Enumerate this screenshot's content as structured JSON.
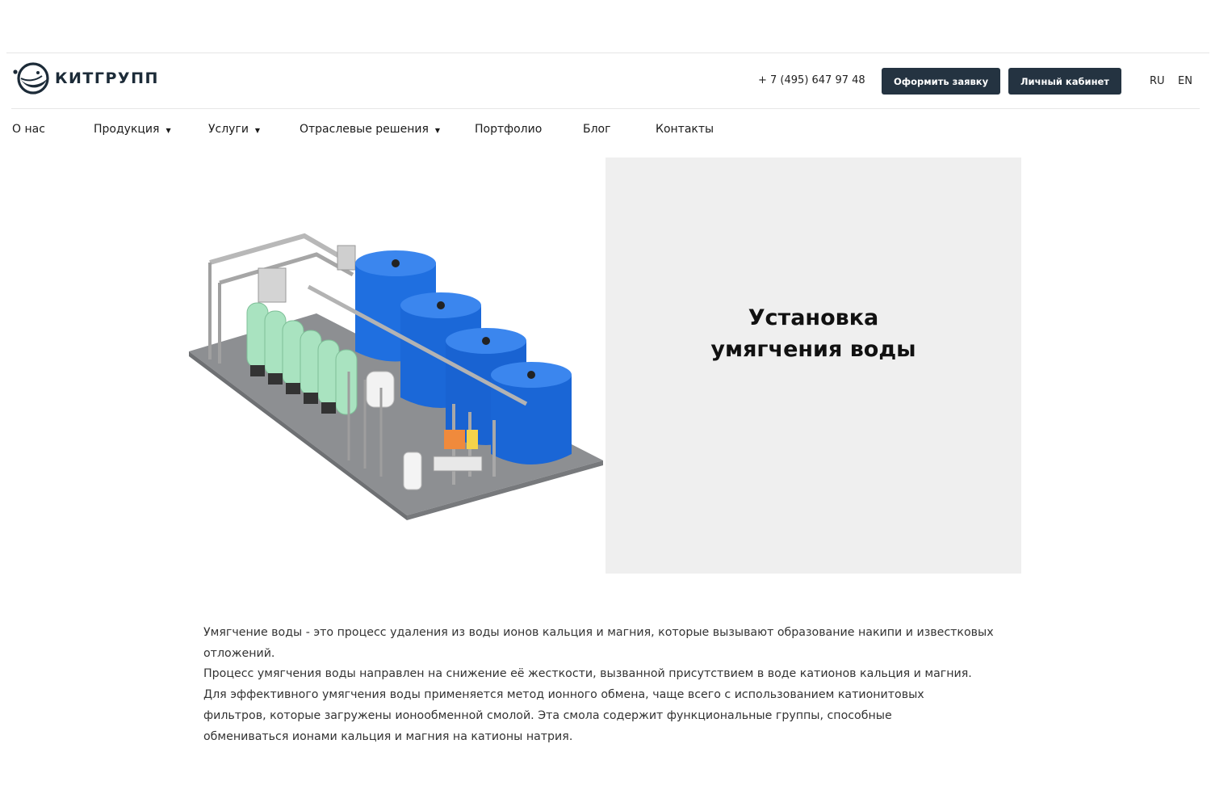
{
  "brand": {
    "name": "КИТГРУПП"
  },
  "header": {
    "phone": "+ 7 (495) 647 97 48",
    "order_button": "Оформить заявку",
    "cabinet_button": "Личный кабинет",
    "languages": [
      "RU",
      "EN"
    ]
  },
  "nav": {
    "items": [
      {
        "label": "О нас",
        "has_dropdown": false
      },
      {
        "label": "Продукция",
        "has_dropdown": true
      },
      {
        "label": "Услуги",
        "has_dropdown": true
      },
      {
        "label": "Отраслевые решения",
        "has_dropdown": true
      },
      {
        "label": "Портфолио",
        "has_dropdown": false
      },
      {
        "label": "Блог",
        "has_dropdown": false
      },
      {
        "label": "Контакты",
        "has_dropdown": false
      }
    ]
  },
  "hero": {
    "title": "Установка умягчения воды",
    "image": "water-softening-plant-illustration"
  },
  "content": {
    "paragraphs": [
      "Умягчение воды - это процесс удаления из воды ионов кальция и магния, которые вызывают образование накипи и известковых отложений.",
      "Процесс умягчения воды направлен на снижение её жесткости, вызванной присутствием в воде катионов кальция и магния. Для эффективного умягчения воды применяется метод ионного обмена, чаще всего с использованием катионитовых фильтров, которые загружены ионообменной смолой. Эта смола содержит функциональные группы, способные обмениваться ионами кальция и магния на катионы натрия."
    ]
  },
  "colors": {
    "button_bg": "#243341",
    "logo": "#1c2b38",
    "hero_box_bg": "#efefef",
    "tank_blue": "#1f6fe0",
    "filter_green": "#a9e3c0"
  }
}
